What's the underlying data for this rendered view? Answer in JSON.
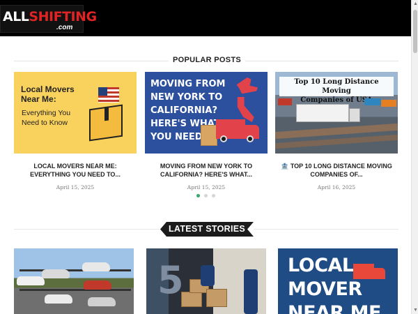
{
  "header": {
    "logo_main_white": "ALL",
    "logo_main_red": "SHIFTING",
    "logo_sub": ".com"
  },
  "popular": {
    "heading": "POPULAR POSTS",
    "posts": [
      {
        "image_text_line1": "Local Movers",
        "image_text_line2": "Near Me:",
        "image_text_line3": "Everything You",
        "image_text_line4": "Need to Know",
        "title": "LOCAL MOVERS NEAR ME: EVERYTHING YOU NEED TO...",
        "date": "April 15, 2025"
      },
      {
        "image_text_line1": "MOVING FROM",
        "image_text_line2": "NEW YORK TO",
        "image_text_line3": "CALIFORNIA?",
        "image_text_line4": "HERE'S WHAT",
        "image_text_line5": "YOU NEED",
        "title": "MOVING FROM NEW YORK TO CALIFORNIA? HERE'S WHAT...",
        "date": "April 15, 2025"
      },
      {
        "image_text_line1": "Top 10 Long Distance Moving",
        "image_text_line2": "Companies of USA",
        "title_icon": "🏦",
        "title": "TOP 10 LONG DISTANCE MOVING COMPANIES OF...",
        "date": "April 16, 2025"
      }
    ],
    "carousel": {
      "active_index": 0,
      "dot_count": 3
    }
  },
  "latest": {
    "heading": "LATEST STORIES",
    "stories": [
      {
        "image_icon": "cars-on-rack-image"
      },
      {
        "image_icon": "movers-with-boxes-image",
        "image_text": "5"
      },
      {
        "image_text_line1": "LOCAL",
        "image_text_line2": "MOVER",
        "image_text_line3": "NEAR ME"
      }
    ]
  },
  "colors": {
    "accent_red": "#e02424",
    "dot_active": "#3aa76d",
    "header_bg": "#000000"
  }
}
